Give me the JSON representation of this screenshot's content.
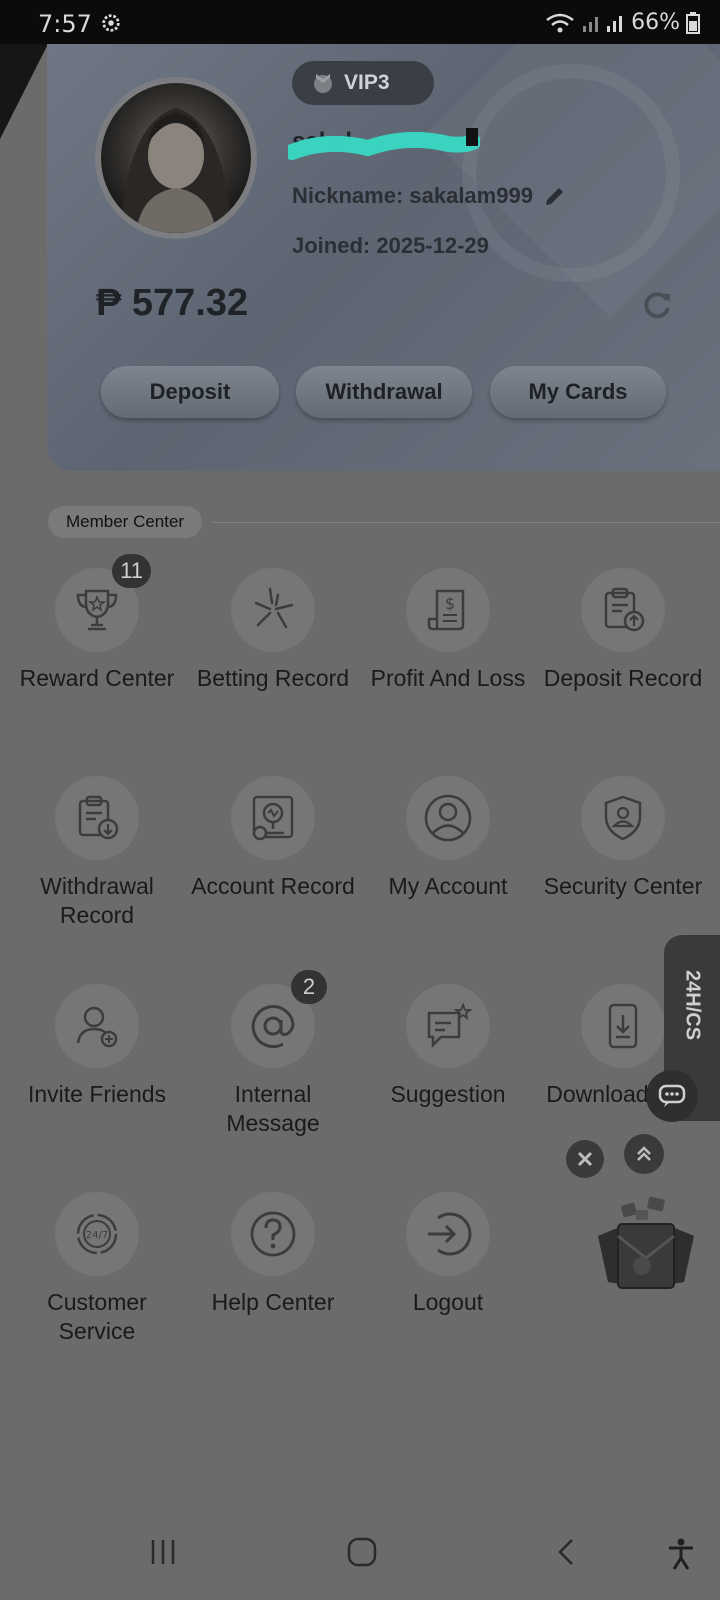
{
  "status_bar": {
    "time": "7:57",
    "battery": "66%"
  },
  "profile": {
    "vip_level": "VIP3",
    "username": "sakal",
    "nickname": "Nickname: sakalam999",
    "joined_label": "Joined:",
    "joined_date": "2025-12-29",
    "balance": "₱ 577.32"
  },
  "actions": {
    "deposit": "Deposit",
    "withdrawal": "Withdrawal",
    "my_cards": "My Cards"
  },
  "section_title": "Member Center",
  "menu": [
    {
      "label": "Reward Center",
      "badge": "11"
    },
    {
      "label": "Betting Record"
    },
    {
      "label": "Profit And Loss"
    },
    {
      "label": "Deposit Record"
    },
    {
      "label": "Withdrawal Record"
    },
    {
      "label": "Account Record"
    },
    {
      "label": "My Account"
    },
    {
      "label": "Security Center"
    },
    {
      "label": "Invite Friends"
    },
    {
      "label": "Internal Message",
      "badge": "2"
    },
    {
      "label": "Suggestion"
    },
    {
      "label": "Download APP"
    },
    {
      "label": "Customer Service"
    },
    {
      "label": "Help Center"
    },
    {
      "label": "Logout"
    }
  ],
  "cs_tab_label": "24H/CS",
  "colors": {
    "overlay_bg": "#6b6b6b",
    "card_bg": "#666d79",
    "badge_bg": "#333333",
    "scribble": "#39d3c0"
  }
}
